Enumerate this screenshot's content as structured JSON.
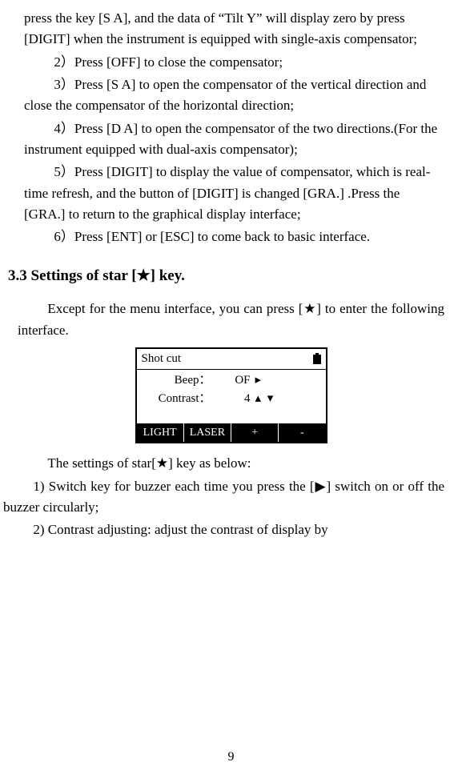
{
  "p1": "press the key [S A], and the data of “Tilt Y” will display zero by press [DIGIT] when the instrument is equipped with single-axis compensator;",
  "p2": "2）Press [OFF] to close the compensator;",
  "p3": "3）Press [S A] to open the compensator of the vertical direction and close the compensator of the horizontal direction;",
  "p4": "4）Press [D A] to open the compensator of the two directions.(For the instrument equipped with dual-axis compensator);",
  "p5": "5）Press [DIGIT] to display the value of compensator, which is real-time refresh, and the button of [DIGIT] is changed [GRA.] .Press the [GRA.] to return to the graphical display interface;",
  "p6": "6）Press [ENT] or [ESC] to come back to basic interface.",
  "heading": "3.3 Settings of star [★] key.",
  "p7": "Except for the menu interface, you can press [★] to enter the following interface.",
  "lcd": {
    "title": "Shot cut",
    "rows": [
      {
        "label": "Beep：",
        "value": "OF",
        "ctrl": "▸"
      },
      {
        "label": "Contrast：",
        "value": "4",
        "ctrl": "▴ ▾"
      }
    ],
    "buttons": [
      "LIGHT",
      "LASER",
      "+",
      "-"
    ]
  },
  "p8": "The settings of star[★] key as below:",
  "p9": "1) Switch key for buzzer each time you press the [▶] switch on or off the buzzer circularly;",
  "p10": "2) Contrast adjusting: adjust the contrast of display by",
  "pagenum": "9"
}
